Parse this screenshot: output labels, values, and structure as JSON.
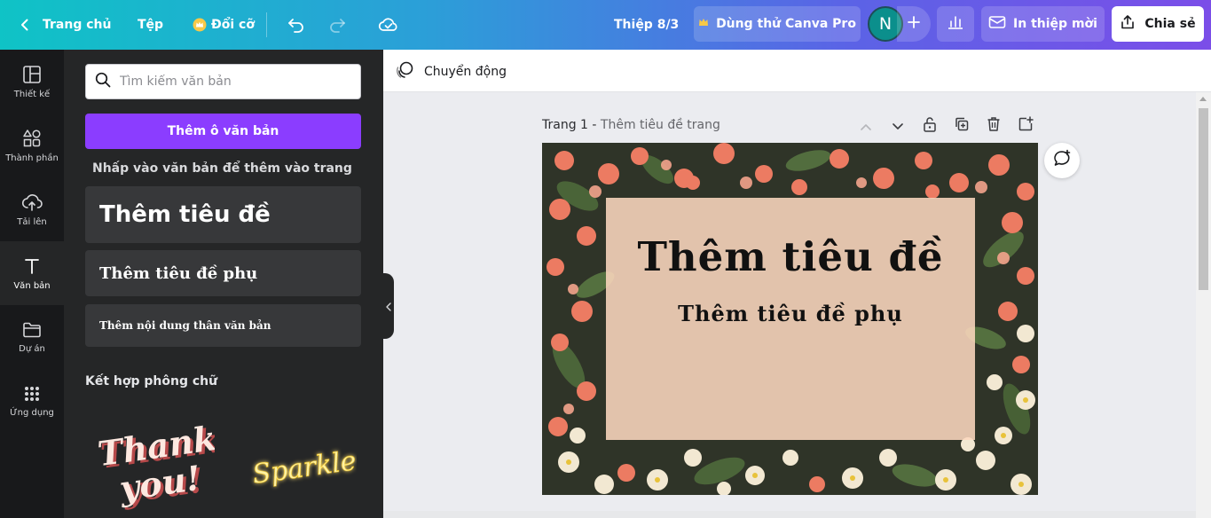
{
  "topbar": {
    "home_label": "Trang chủ",
    "file_label": "Tệp",
    "resize_label": "Đổi cỡ",
    "doc_title": "Thiệp 8/3",
    "pro_trial_label": "Dùng thử Canva Pro",
    "avatar_initial": "N",
    "print_label": "In thiệp mời",
    "share_label": "Chia sẻ"
  },
  "rail": {
    "items": [
      {
        "label": "Thiết kế",
        "icon": "layout-icon"
      },
      {
        "label": "Thành phần",
        "icon": "shapes-icon"
      },
      {
        "label": "Tải lên",
        "icon": "upload-cloud-icon"
      },
      {
        "label": "Văn bản",
        "icon": "text-icon"
      },
      {
        "label": "Dự án",
        "icon": "folder-icon"
      },
      {
        "label": "Ứng dụng",
        "icon": "apps-grid-icon"
      }
    ]
  },
  "panel": {
    "search_placeholder": "Tìm kiếm văn bản",
    "add_text_button": "Thêm ô văn bản",
    "hint": "Nhấp vào văn bản để thêm vào trang",
    "heading_sample": "Thêm tiêu đề",
    "subheading_sample": "Thêm tiêu đề phụ",
    "body_sample": "Thêm nội dung thân văn bản",
    "font_combos_title": "Kết hợp phông chữ",
    "combo_1_line1": "Thank",
    "combo_1_line2": "you!",
    "combo_2": "Sparkle"
  },
  "toolbar": {
    "motion_label": "Chuyển động"
  },
  "page": {
    "number_label": "Trang 1 -",
    "title_placeholder": "Thêm tiêu đề trang"
  },
  "design": {
    "title": "Thêm tiêu đề",
    "subtitle": "Thêm tiêu đề phụ"
  },
  "colors": {
    "accent_purple": "#8b3dff",
    "panel_bg": "#252627",
    "rail_bg": "#18191b",
    "avatar_bg": "#0b8f8c"
  }
}
